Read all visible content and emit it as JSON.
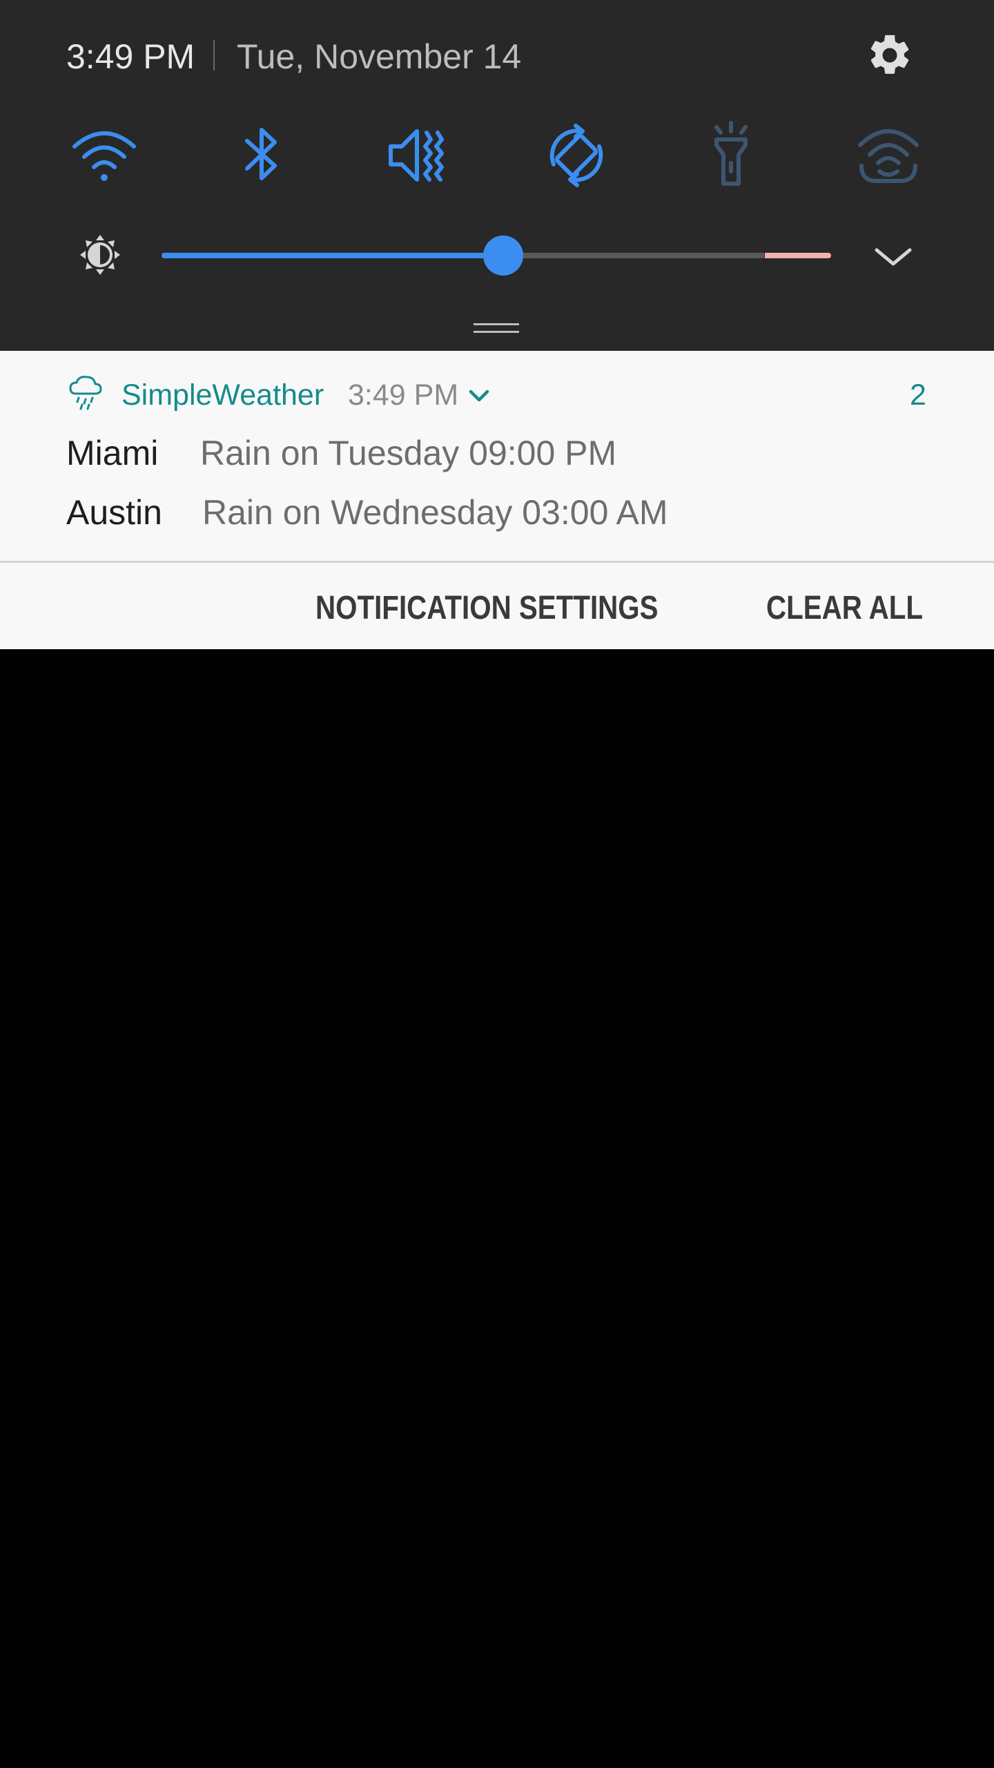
{
  "status": {
    "time": "3:49 PM",
    "date": "Tue, November 14"
  },
  "quick_settings": {
    "toggles": [
      {
        "icon": "wifi-icon",
        "state": "on"
      },
      {
        "icon": "bluetooth-icon",
        "state": "on"
      },
      {
        "icon": "vibrate-icon",
        "state": "on"
      },
      {
        "icon": "auto-rotate-icon",
        "state": "on"
      },
      {
        "icon": "flashlight-icon",
        "state": "off"
      },
      {
        "icon": "mobile-hotspot-icon",
        "state": "off"
      }
    ],
    "brightness": {
      "level": 0.51,
      "high_zone_start": 0.9
    }
  },
  "notification": {
    "app_name": "SimpleWeather",
    "time": "3:49 PM",
    "count": "2",
    "items": [
      {
        "city": "Miami",
        "detail": "Rain on Tuesday 09:00 PM"
      },
      {
        "city": "Austin",
        "detail": "Rain on Wednesday 03:00 AM"
      }
    ]
  },
  "actions": {
    "settings_label": "NOTIFICATION SETTINGS",
    "clear_label": "CLEAR ALL"
  },
  "colors": {
    "panel_bg": "#282828",
    "accent_blue": "#3b8ef0",
    "app_teal": "#158b8b",
    "disabled_icon": "#3d5670"
  }
}
